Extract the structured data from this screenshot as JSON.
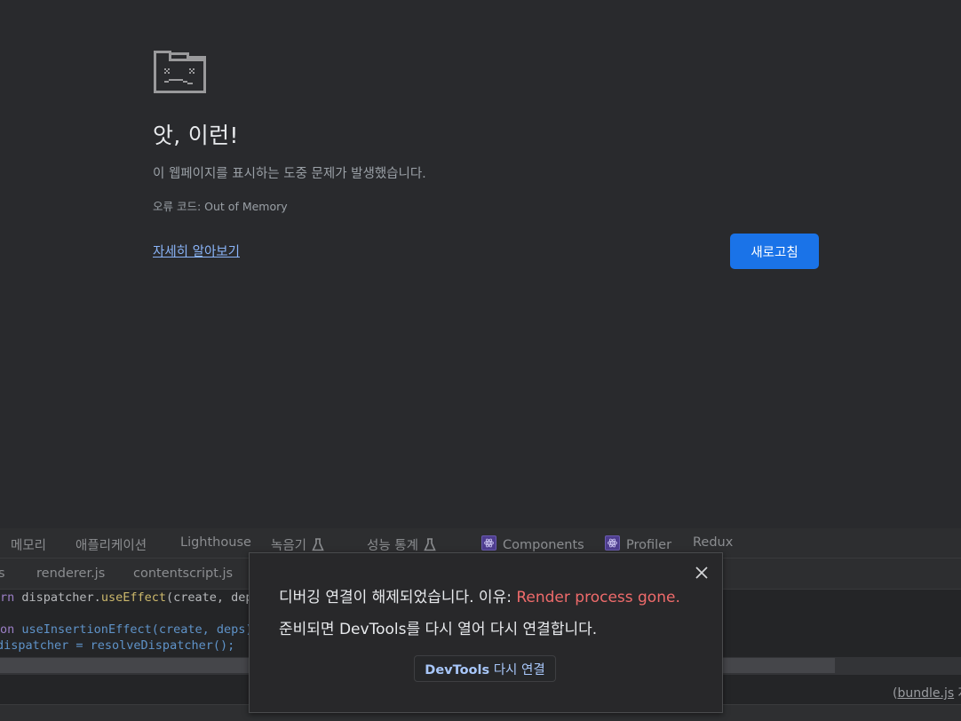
{
  "crash_page": {
    "icon": "sad-folder-icon",
    "title": "앗, 이런!",
    "description": "이 웹페이지를 표시하는 도중 문제가 발생했습니다.",
    "error_code_label": "오류 코드: ",
    "error_code": "Out of Memory",
    "learn_more_link": "자세히 알아보기",
    "reload_button": "새로고침",
    "accent_color": "#1a73e8"
  },
  "devtools": {
    "main_tabs": [
      {
        "label": "메모리"
      },
      {
        "label": "애플리케이션"
      },
      {
        "label": "Lighthouse"
      },
      {
        "label": "녹음기",
        "icon": "flask-icon"
      },
      {
        "label": "성능 통계",
        "icon": "flask-icon"
      },
      {
        "label": "Components",
        "icon": "react-icon"
      },
      {
        "label": "Profiler",
        "icon": "react-icon"
      },
      {
        "label": "Redux"
      }
    ],
    "file_tabs": [
      {
        "label": "s"
      },
      {
        "label": "renderer.js"
      },
      {
        "label": "contentscript.js"
      }
    ],
    "code_lines": [
      {
        "kw": "rn",
        "obj": " dispatcher.",
        "fn": "useEffect",
        "rest": "(create, dep"
      },
      {
        "kw": "on",
        "obj": " ",
        "fn": "useInsertionEffect",
        "rest": "(create, deps)"
      },
      {
        "kw": "",
        "obj": "dispatcher = resolveDispatcher();",
        "fn": "",
        "rest": ""
      }
    ],
    "source_link_prefix": "(",
    "source_link": "bundle.js",
    "source_link_suffix": " 자"
  },
  "dialog": {
    "message_prefix": "디버깅 연결이 해제되었습니다. 이유: ",
    "reason": "Render process gone.",
    "message_line2": "준비되면 DevTools를 다시 열어 다시 연결합니다.",
    "reconnect_button_bold": "DevTools",
    "reconnect_button_rest": " 다시 연결",
    "close_icon": "close-icon",
    "reason_color": "#ef6b6b"
  }
}
